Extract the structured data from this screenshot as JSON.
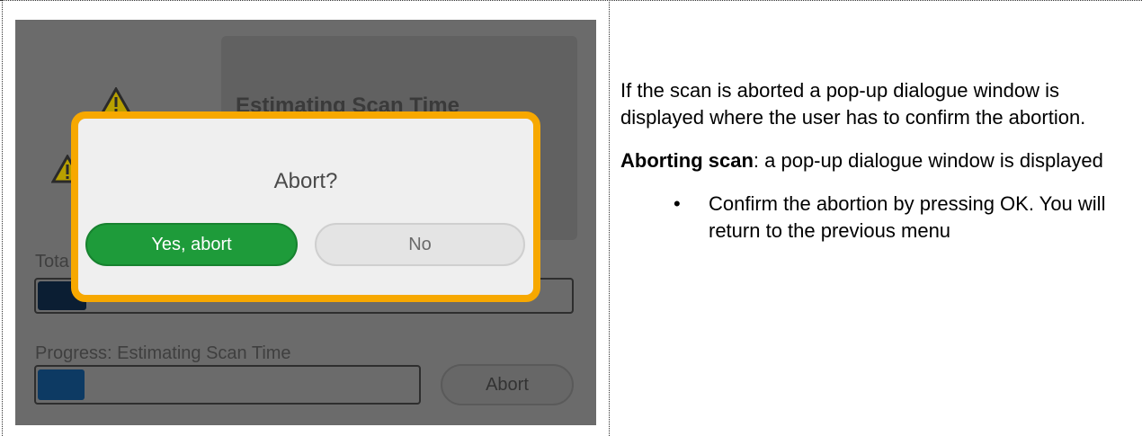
{
  "screenshot": {
    "background_title": "Estimating Scan Time",
    "total_label": "Tota",
    "progress_label": "Progress: Estimating Scan Time",
    "progress_fraction": 0.12,
    "total_fraction": 0.09,
    "abort_button_label": "Abort",
    "warning_icons": [
      "warning-icon",
      "warning-icon"
    ],
    "dialog": {
      "title": "Abort?",
      "yes_label": "Yes, abort",
      "no_label": "No",
      "accent_color": "#f7a800",
      "yes_color": "#1e9b3a"
    }
  },
  "description": {
    "para1": "If the scan is aborted a pop-up dialogue window is displayed where the user has to confirm the abortion.",
    "para2_bold": "Aborting scan",
    "para2_rest": ": a pop-up dialogue window is displayed",
    "bullet_glyph": "•",
    "bullet1": "Confirm the abortion by pressing OK. You will return to the previous menu"
  }
}
